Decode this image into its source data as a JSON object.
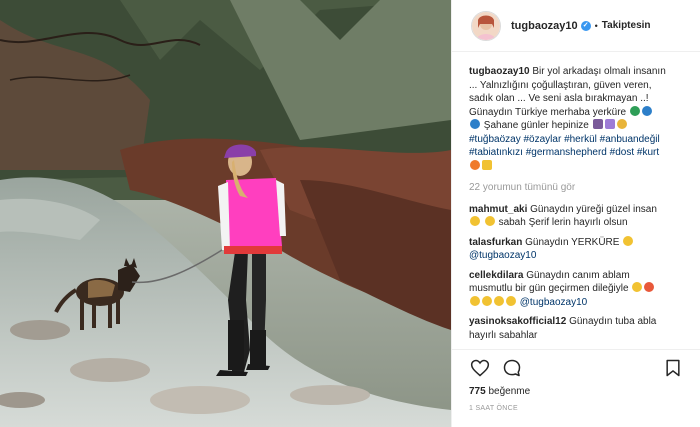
{
  "post": {
    "username": "tugbaozay10",
    "verified": true,
    "separator": "•",
    "follow_label": "Takiptesin",
    "caption_lines": {
      "l1": "Bir yol arkadaşı olmalı insanın",
      "l2": "... Yalnızlığını çoğullaştıran, güven veren,",
      "l3": "sadık olan ... Ve seni asla bırakmayan ..!",
      "l4": "Günaydın Türkiye merhaba yerküre",
      "l5": "Şahane günler hepinize",
      "tags1": "#tuğbaözay #özaylar #herkül #anbuandeğil",
      "tags2": "#tabiatınkızı #germanshepherd #dost #kurt"
    },
    "view_all": "22 yorumun tümünü gör"
  },
  "comments": [
    {
      "user": "mahmut_aki",
      "text1": "Günaydın yüreği güzel insan",
      "text2": "sabah Şerif lerin hayırlı olsun"
    },
    {
      "user": "talasfurkan",
      "text1": "Günaydın YERKÜRE",
      "mention": "@tugbaozay10"
    },
    {
      "user": "cellekdilara",
      "text1": "Günaydın canım ablam",
      "text2": "musmutlu bir gün geçirmen dileğiyle",
      "mention": "@tugbaozay10"
    },
    {
      "user": "yasinoksakofficial12",
      "text1": "Günaydın tuba abla",
      "text2": "hayırlı sabahlar"
    }
  ],
  "footer": {
    "likes_count": "775",
    "likes_label": "beğenme",
    "time": "1 SAAT ÖNCE"
  },
  "icons": {
    "like": "heart-icon",
    "comment": "comment-bubble-icon",
    "save": "bookmark-icon"
  },
  "colors": {
    "tag": "#003569",
    "verified": "#3897f0",
    "muted": "#999999",
    "jacket": "#ff3fbf"
  }
}
